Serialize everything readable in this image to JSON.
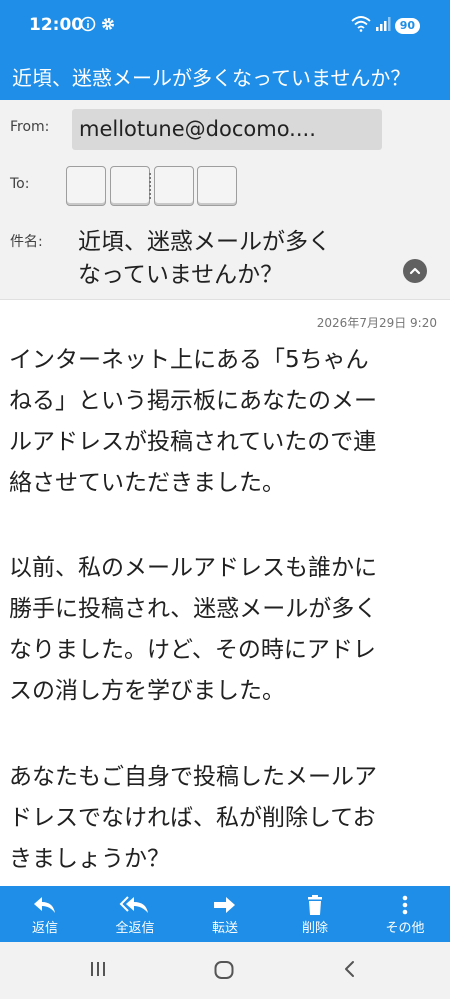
{
  "status_bar": {
    "time": "12:00",
    "battery": "90",
    "icons": [
      "info-icon",
      "gear-icon",
      "wifi-icon",
      "signal-icon",
      "battery-icon"
    ]
  },
  "title_bar": {
    "title": "近頃、迷惑メールが多くなっていませんか？"
  },
  "header": {
    "from_label": "From:",
    "from_value": "mellotune@docomo....",
    "to_label": "To:",
    "subject_label": "件名:",
    "subject_lines": [
      "近頃、迷惑メールが多く",
      "なっていませんか？"
    ]
  },
  "message": {
    "date": "2026年7月29日 9:20",
    "paragraphs": [
      [
        "インターネット上にある「5ちゃん",
        "ねる」という掲示板にあなたのメー",
        "ルアドレスが投稿されていたので連",
        "絡させていただきました。"
      ],
      [
        "以前、私のメールアドレスも誰かに",
        "勝手に投稿され、迷惑メールが多く",
        "なりました。けど、その時にアドレ",
        "スの消し方を学びました。"
      ],
      [
        "あなたもご自身で投稿したメールア",
        "ドレスでなければ、私が削除してお",
        "きましょうか？"
      ]
    ]
  },
  "toolbar": {
    "items": [
      {
        "label": "返信",
        "icon": "reply-icon"
      },
      {
        "label": "全返信",
        "icon": "reply-all-icon"
      },
      {
        "label": "転送",
        "icon": "forward-icon"
      },
      {
        "label": "削除",
        "icon": "trash-icon"
      },
      {
        "label": "その他",
        "icon": "more-vert-icon"
      }
    ]
  },
  "nav_bar": {
    "icons": [
      "recent-apps-icon",
      "home-icon",
      "back-icon"
    ]
  },
  "colors": {
    "primary": "#1e8ee8",
    "header_bg": "#f2f2f2",
    "text": "#212121"
  }
}
